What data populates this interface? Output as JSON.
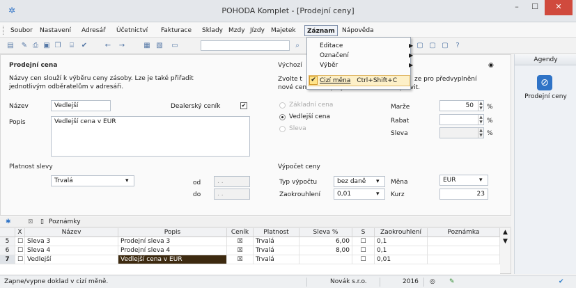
{
  "window": {
    "title": "POHODA Komplet - [Prodejní ceny]",
    "logo_icon": "pohoda-logo-icon"
  },
  "menu": {
    "items": [
      "Soubor",
      "Nastavení",
      "Adresář",
      "Účetnictví",
      "Fakturace",
      "Sklady",
      "Mzdy",
      "Jízdy",
      "Majetek",
      "Záznam",
      "Nápověda"
    ],
    "active": "Záznam"
  },
  "dropdown": {
    "items": [
      {
        "label": "Editace",
        "submenu": true
      },
      {
        "label": "Označení",
        "submenu": true
      },
      {
        "label": "Výběr",
        "submenu": true
      },
      {
        "label": "Cizí měna",
        "shortcut": "Ctrl+Shift+C",
        "checked": true
      }
    ]
  },
  "form": {
    "left_section": "Prodejní cena",
    "left_desc": "Názvy cen slouží k výběru ceny zásoby. Lze je také přiřadit jednotlivým odběratelům v adresáři.",
    "name_label": "Název",
    "name_value": "Vedlejší",
    "dealer_label": "Dealerský ceník",
    "dealer_checked": true,
    "desc_label": "Popis",
    "desc_value": "Vedlejší cena v EUR",
    "validity_section": "Platnost slevy",
    "validity_value": "Trvalá",
    "od_label": "od",
    "do_label": "do",
    "date_placeholder": ". .",
    "right_section": "Výchozí",
    "right_desc_line1": "Zvolte t",
    "right_desc_tail1": "ze pro předvyplnění",
    "right_desc_line2": "nové cenové skupiny, kterou můžete upravit.",
    "radio_options": [
      {
        "label": "Základní cena",
        "state": "disabled"
      },
      {
        "label": "Vedlejší cena",
        "state": "selected"
      },
      {
        "label": "Sleva",
        "state": "disabled"
      }
    ],
    "marze_label": "Marže",
    "marze_value": "50",
    "rabat_label": "Rabat",
    "rabat_value": "",
    "sleva_label": "Sleva",
    "sleva_value": "",
    "percent": "%",
    "calc_section": "Výpočet ceny",
    "calc_type_label": "Typ výpočtu",
    "calc_type_value": "bez daně",
    "rounding_label": "Zaokrouhlení",
    "rounding_value": "0,01",
    "currency_label": "Měna",
    "currency_value": "EUR",
    "rate_label": "Kurz",
    "rate_value": "23"
  },
  "agendy": {
    "title": "Agendy",
    "item_label": "Prodejní ceny",
    "item_icon": "prodejni-ceny-icon"
  },
  "tabs": {
    "notes_label": "Poznámky"
  },
  "table": {
    "headers": [
      "X",
      "Název",
      "Popis",
      "Ceník",
      "Platnost",
      "Sleva %",
      "S",
      "Zaokrouhlení",
      "Poznámka"
    ],
    "rows": [
      {
        "num": "5",
        "name": "Sleva 3",
        "desc": "Prodejní sleva 3",
        "cenik": "☒",
        "platnost": "Trvalá",
        "sleva": "6,00",
        "round": "0,1",
        "note": ""
      },
      {
        "num": "6",
        "name": "Sleva 4",
        "desc": "Prodejní sleva 4",
        "cenik": "☒",
        "platnost": "Trvalá",
        "sleva": "8,00",
        "round": "0,1",
        "note": ""
      },
      {
        "num": "7",
        "name": "Vedlejší",
        "desc": "Vedlejší cena v EUR",
        "cenik": "☒",
        "platnost": "Trvalá",
        "sleva": "",
        "round": "0,01",
        "note": ""
      }
    ]
  },
  "status": {
    "message": "Zapne/vypne doklad v cizí měně.",
    "company": "Novák s.r.o.",
    "year": "2016"
  }
}
